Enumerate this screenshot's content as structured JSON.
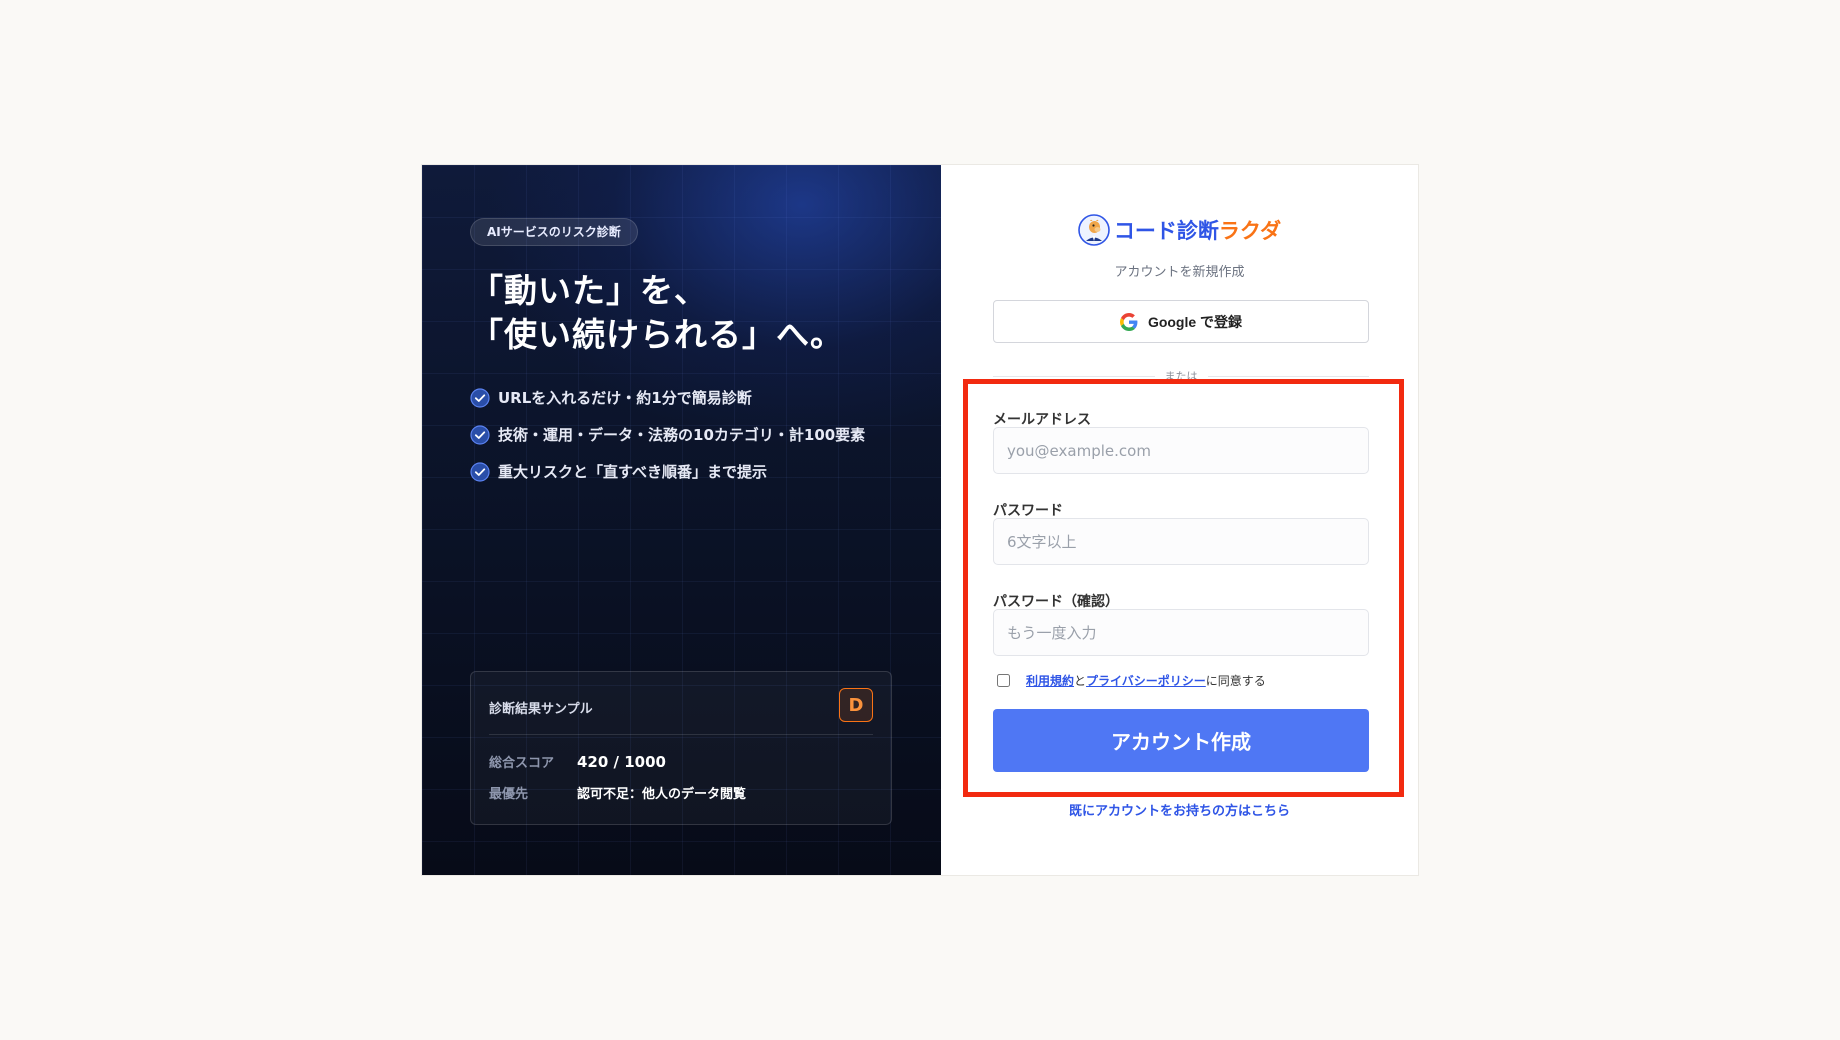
{
  "hero": {
    "badge": "AIサービスのリスク診断",
    "headline_line1": "「動いた」を、",
    "headline_line2": "「使い続けられる」へ。",
    "features": [
      "URLを入れるだけ・約1分で簡易診断",
      "技術・運用・データ・法務の10カテゴリ・計100要素",
      "重大リスクと「直すべき順番」まで提示"
    ],
    "sample": {
      "title": "診断結果サンプル",
      "grade": "D",
      "score_label": "総合スコア",
      "score_value": "420 / 1000",
      "priority_label": "最優先",
      "priority_value": "認可不足：他人のデータ閲覧"
    }
  },
  "brand": {
    "name_part1": "コード診断",
    "name_part2": "ラクダ",
    "logo_icon": "camel-mascot-icon"
  },
  "form": {
    "subtitle": "アカウントを新規作成",
    "google_button": "Google で登録",
    "divider": "または",
    "email_label": "メールアドレス",
    "email_placeholder": "you@example.com",
    "email_value": "",
    "password_label": "パスワード",
    "password_placeholder": "6文字以上",
    "password_value": "",
    "confirm_label": "パスワード（確認）",
    "confirm_placeholder": "もう一度入力",
    "confirm_value": "",
    "terms_link": "利用規約",
    "terms_and": "と",
    "privacy_link": "プライバシーポリシー",
    "terms_suffix": "に同意する",
    "terms_checked": false,
    "submit": "アカウント作成",
    "login_link": "既にアカウントをお持ちの方はこちら"
  },
  "colors": {
    "accent": "#4f77f4",
    "brand_blue": "#2f55e6",
    "brand_orange": "#f97316",
    "highlight": "#f22a10"
  }
}
